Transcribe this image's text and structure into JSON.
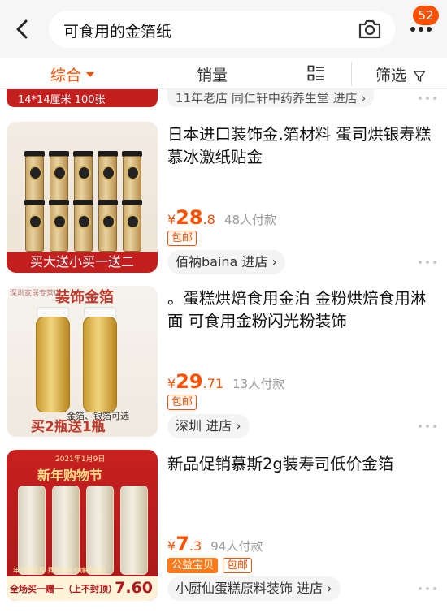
{
  "header": {
    "search_query": "可食用的金箔纸",
    "message_count": "52"
  },
  "tabs": {
    "comprehensive": "综合",
    "sales": "销量",
    "filter": "筛选"
  },
  "previous_item": {
    "thumb_text": "14*14厘米     100张",
    "shop": "11年老店 同仁轩中药养生堂 进店 ›"
  },
  "products": [
    {
      "title": "日本进口装饰金.箔材料 蛋司烘银寿糕慕冰激纸贴金",
      "price_currency": "¥",
      "price_int": "28",
      "price_dec": ".8",
      "sold": "48人付款",
      "tags": [
        "包邮"
      ],
      "shop": "佰衲baina 进店 ›",
      "thumb_banner": "买大送小买一送二"
    },
    {
      "title": "。蛋糕烘焙食用金泊 金粉烘焙食用淋面 可食用金粉闪光粉装饰",
      "price_currency": "¥",
      "price_int": "29",
      "price_dec": ".71",
      "sold": "13人付款",
      "tags": [
        "包邮"
      ],
      "shop": "深圳 进店 ›",
      "thumb_shop": "深圳家居专营店",
      "thumb_title": "装饰金箔",
      "thumb_note": "金箔、银箔可选",
      "thumb_banner": "买2瓶送1瓶"
    },
    {
      "title": "新品促销慕斯2g装寿司低价金箔",
      "price_currency": "¥",
      "price_int": "7",
      "price_dec": ".3",
      "sold": "94人付款",
      "tags": [
        "公益宝贝",
        "包邮"
      ],
      "shop": "小厨仙蛋糕原料装饰 进店 ›",
      "thumb_date": "2021年1月9日",
      "thumb_title": "新年购物节",
      "thumb_sub": "年货提前购  拜年送礼价廉物美款",
      "thumb_footer": "全场买一赠一（上不封顶）",
      "thumb_price": "7.60"
    }
  ],
  "colors": {
    "accent": "#ff5000",
    "header_bg": "#f6f6f6",
    "badge": "#ff5000"
  },
  "icons": [
    "back-arrow-icon",
    "camera-icon",
    "more-dots-icon",
    "caret-down-icon",
    "list-view-icon",
    "filter-funnel-icon",
    "more-options-icon"
  ]
}
